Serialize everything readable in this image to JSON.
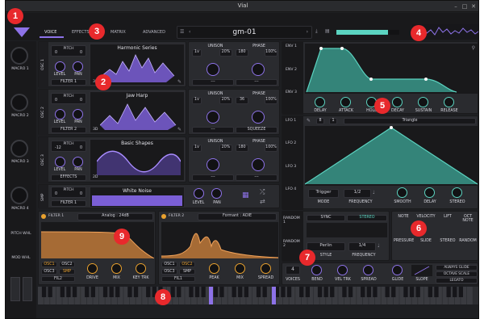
{
  "window": {
    "title": "Vial"
  },
  "badges": [
    "1",
    "2",
    "3",
    "4",
    "5",
    "6",
    "7",
    "8",
    "9"
  ],
  "tabs": [
    "VOICE",
    "EFFECTS",
    "MATRIX",
    "ADVANCED"
  ],
  "preset": {
    "name": "gm-01"
  },
  "macros": [
    "MACRO 1",
    "MACRO 2",
    "MACRO 3",
    "MACRO 4"
  ],
  "left_labels": {
    "pitch": "PITCH WHL",
    "mod": "MOD WHL"
  },
  "oscillators": [
    {
      "label": "OSC 1",
      "pitch_top": "0",
      "pitch_bot": "0",
      "wave": "Harmonic Series",
      "unison_voices": "1v",
      "unison_pct": "20%",
      "phase": "180",
      "phase_pct": "100%",
      "dest": "FILTER 1",
      "mode": "---",
      "dim": "3D"
    },
    {
      "label": "OSC 2",
      "pitch_top": "0",
      "pitch_bot": "0",
      "wave": "Jaw Harp",
      "unison_voices": "1v",
      "unison_pct": "20%",
      "phase": "36",
      "phase_pct": "100%",
      "dest": "FILTER 2",
      "mode": "SQUEEZE",
      "dim": "3D"
    },
    {
      "label": "OSC 3",
      "pitch_top": "-12",
      "pitch_bot": "0",
      "wave": "Basic Shapes",
      "unison_voices": "1v",
      "unison_pct": "20%",
      "phase": "180",
      "phase_pct": "100%",
      "dest": "EFFECTS",
      "mode": "---",
      "dim": "2D"
    }
  ],
  "smp": {
    "label": "SMP",
    "pitch_top": "0",
    "pitch_bot": "0",
    "name": "White Noise",
    "dest": "FILTER 1"
  },
  "osc_labels": {
    "pitch": "PITCH",
    "level": "LEVEL",
    "pan": "PAN",
    "unison": "UNISON",
    "phase": "PHASE"
  },
  "filters": [
    {
      "label": "FILTER 1",
      "type": "Analog : 24dB",
      "inputs": [
        "OSC1",
        "OSC2",
        "OSC3",
        "SMP",
        "FIL2"
      ],
      "knobs": [
        "DRIVE",
        "MIX",
        "KEY TRK"
      ]
    },
    {
      "label": "FILTER 2",
      "type": "Formant : AOIE",
      "inputs": [
        "OSC1",
        "OSC2",
        "OSC3",
        "SMP",
        "FIL1"
      ],
      "knobs": [
        "PEAK",
        "MIX",
        "SPREAD"
      ]
    }
  ],
  "envelopes": [
    "ENV 1",
    "ENV 2",
    "ENV 3"
  ],
  "env_knobs": [
    "DELAY",
    "ATTACK",
    "HOLD",
    "DECAY",
    "SUSTAIN",
    "RELEASE"
  ],
  "lfos": [
    "LFO 1",
    "LFO 2",
    "LFO 3",
    "LFO 4"
  ],
  "lfo": {
    "grid": "8",
    "grid2": "1",
    "shape": "Triangle",
    "mode": "Trigger",
    "mode_label": "MODE",
    "freq": "1/2",
    "freq_label": "FREQUENCY",
    "knobs": [
      "SMOOTH",
      "DELAY",
      "STEREO"
    ]
  },
  "randoms": [
    "RANDOM 1",
    "RANDOM 2"
  ],
  "random": {
    "sync": "SYNC",
    "stereo": "STEREO",
    "style": "Perlin",
    "style_label": "STYLE",
    "freq": "1/4",
    "freq_label": "FREQUENCY"
  },
  "mod_sources": [
    "NOTE",
    "VELOCITY",
    "LIFT",
    "OCT NOTE",
    "PRESSURE",
    "SLIDE",
    "STEREO",
    "RANDOM"
  ],
  "voice": {
    "voices": "4",
    "voices_label": "VOICES",
    "knobs": [
      "BEND",
      "VEL TRK",
      "SPREAD"
    ],
    "glide": "GLIDE",
    "slope": "SLOPE",
    "options": [
      "ALWAYS GLIDE",
      "OCTAVE SCALE",
      "LEGATO"
    ]
  },
  "colors": {
    "accent": "#8d72e8",
    "teal": "#5bd3c0",
    "orange": "#e9a12e",
    "badge": "#e8292c"
  }
}
